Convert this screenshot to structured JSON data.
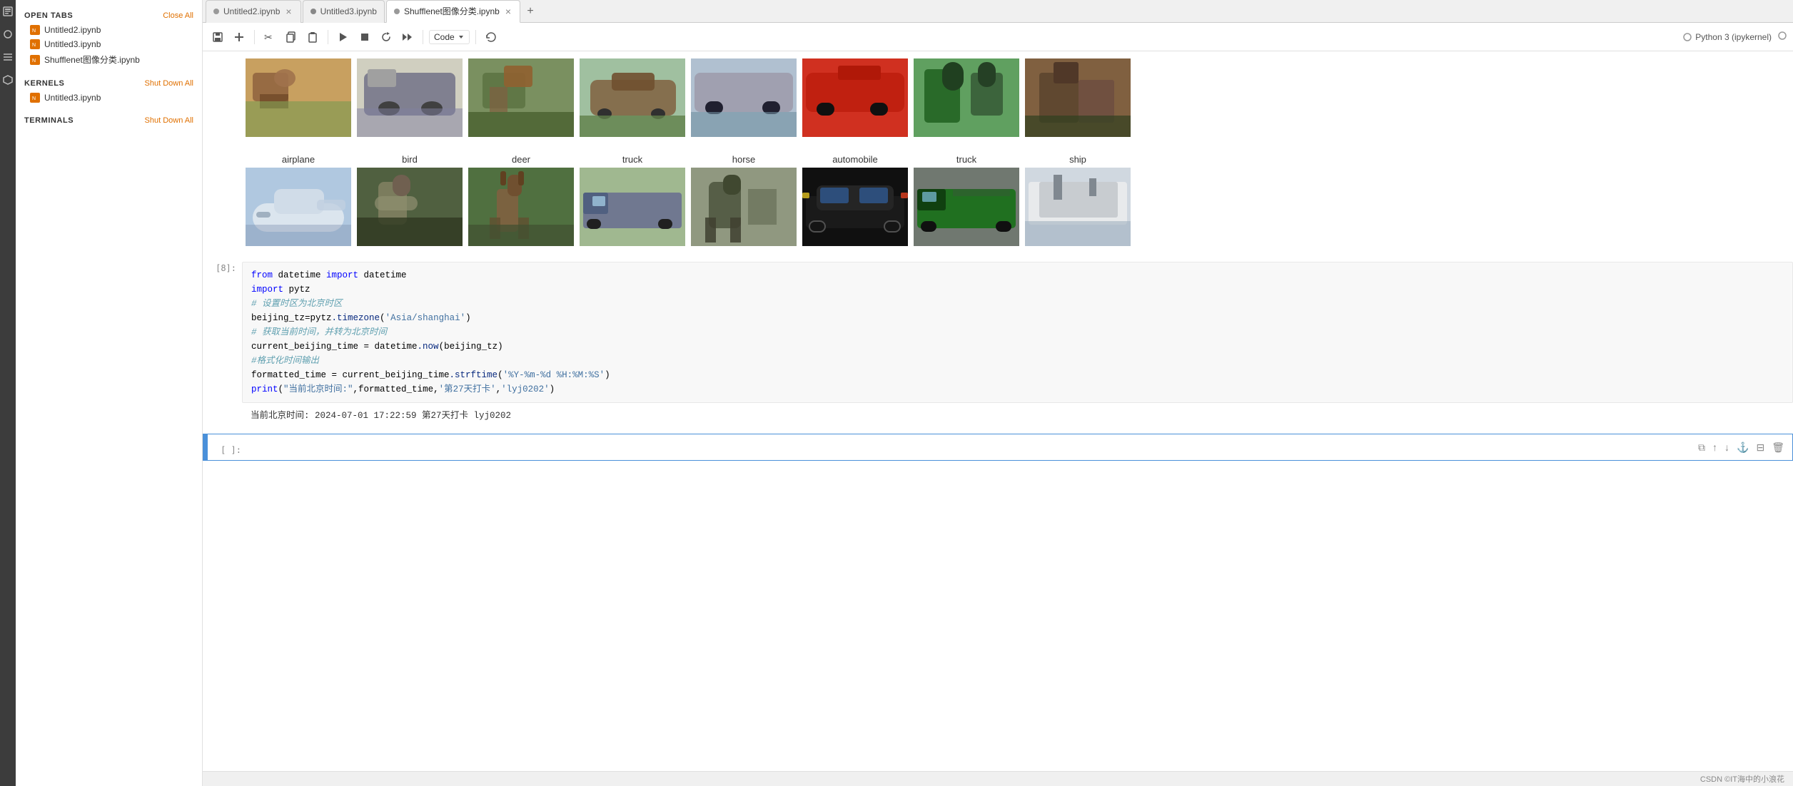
{
  "iconRail": {
    "icons": [
      "⬡",
      "○",
      "≡",
      "◇"
    ]
  },
  "sidebar": {
    "openTabs": {
      "title": "OPEN TABS",
      "closeAll": "Close All",
      "files": [
        {
          "name": "Untitled2.ipynb"
        },
        {
          "name": "Untitled3.ipynb"
        },
        {
          "name": "Shufflenet图像分类.ipynb"
        }
      ]
    },
    "kernels": {
      "title": "KERNELS",
      "shutDownAll": "Shut Down All",
      "files": [
        {
          "name": "Untitled3.ipynb"
        }
      ]
    },
    "terminals": {
      "title": "TERMINALS",
      "shutDownAll": "Shut Down All"
    }
  },
  "tabs": [
    {
      "label": "Untitled2.ipynb",
      "active": false,
      "closable": true
    },
    {
      "label": "Untitled3.ipynb",
      "active": false,
      "closable": false,
      "dot": true
    },
    {
      "label": "Shufflenet图像分类.ipynb",
      "active": true,
      "closable": true
    }
  ],
  "toolbar": {
    "save": "💾",
    "add": "+",
    "cut": "✂",
    "copy": "⧉",
    "paste": "📋",
    "run": "▶",
    "stop": "■",
    "restart": "↺",
    "fastForward": "⏩",
    "cellType": "Code",
    "refresh": "↻",
    "kernelName": "Python 3 (ipykernel)"
  },
  "imageRows": {
    "row1Labels": [],
    "row2Labels": [
      "airplane",
      "bird",
      "deer",
      "truck",
      "horse",
      "automobile",
      "truck",
      "ship"
    ]
  },
  "codeCell": {
    "index": "[8]:",
    "lines": [
      "from datetime import datetime",
      "import pytz",
      "# 设置时区为北京时区",
      "beijing_tz=pytz.timezone('Asia/shanghai')",
      "# 获取当前时间，并转为北京时间",
      "current_beijing_time = datetime.now(beijing_tz)",
      "#格式化时间输出",
      "formatted_time = current_beijing_time.strftime('%Y-%m-%d %H:%M:%S')",
      "print(\"当前北京时间:\",formatted_time,'第27天打卡','lyj0202')"
    ],
    "output": "当前北京时间: 2024-07-01 17:22:59 第27天打卡 lyj0202"
  },
  "emptyCell": {
    "index": "[ ]:",
    "actions": [
      "⧉",
      "↑",
      "↓",
      "⚓",
      "⊡",
      "🗑"
    ]
  },
  "statusBar": {
    "copyright": "CSDN ©IT海中的小浪花"
  },
  "colors": {
    "orange": "#e07000",
    "blue": "#4a90d9",
    "keyword": "#0000ff",
    "string": "#4070a0",
    "comment": "#60a0b0",
    "method": "#06287e"
  }
}
